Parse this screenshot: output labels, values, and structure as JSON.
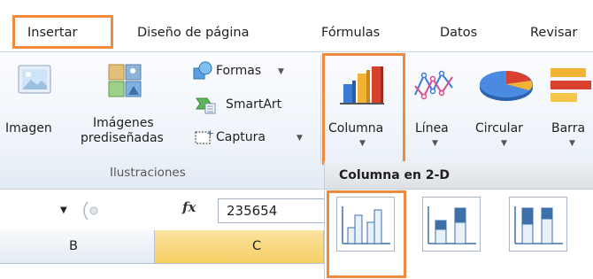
{
  "tabs": [
    {
      "label": "Insertar",
      "active": true
    },
    {
      "label": "Diseño de página"
    },
    {
      "label": "Fórmulas"
    },
    {
      "label": "Datos"
    },
    {
      "label": "Revisar"
    }
  ],
  "ilustraciones": {
    "imagen_label": "Imagen",
    "imagenes_line1": "Imágenes",
    "imagenes_line2": "prediseñadas",
    "formas_label": "Formas",
    "smartart_label": "SmartArt",
    "captura_label": "Captura",
    "group_label": "Ilustraciones"
  },
  "charts": {
    "columna_label": "Columna",
    "linea_label": "Línea",
    "circular_label": "Circular",
    "barra_label": "Barra",
    "gallery_title": "Columna en 2-D"
  },
  "formula_bar": {
    "fx_symbol": "fx",
    "value": "235654"
  },
  "columns": [
    "B",
    "C"
  ],
  "colors": {
    "highlight": "#f08a3c",
    "selected_column_header": "#f9d77e"
  }
}
